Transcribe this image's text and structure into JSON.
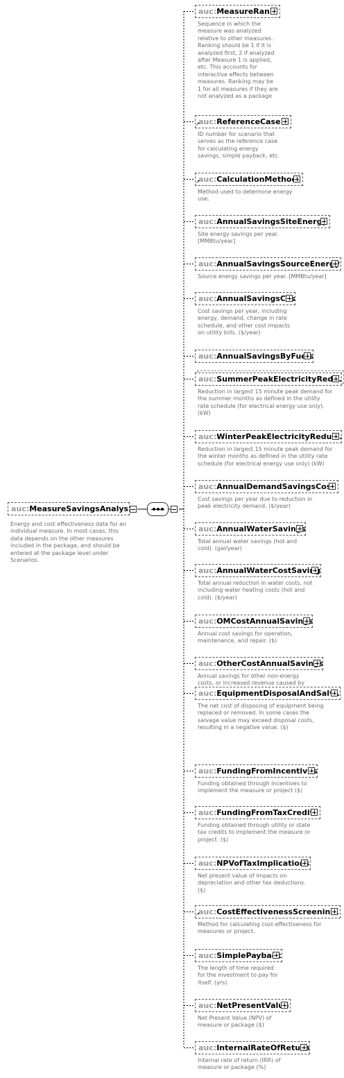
{
  "root": {
    "prefix": "auc:",
    "name": "MeasureSavingsAnalysis",
    "description": [
      "Energy and cost effectiveness data for an",
      "individual measure. In most cases, this",
      "data depends on the other measures",
      "included in the package, and should be",
      "entered at the package level under",
      "Scenarios."
    ]
  },
  "children": [
    {
      "prefix": "auc:",
      "name": "MeasureRank",
      "description": [
        "Sequence in which the",
        "measure was analyzed",
        "relative to other measures.",
        "Ranking should be 1 if it is",
        "analyzed first, 2 if analyzed",
        "after Measure 1 is applied,",
        "etc. This accounts for",
        "interactive effects between",
        "measures. Ranking may be",
        "1 for all measures if they are",
        "not analyzed as a package"
      ]
    },
    {
      "prefix": "auc:",
      "name": "ReferenceCase",
      "description": [
        "ID number for scenario that",
        "serves as the reference case",
        "for calculating energy",
        "savings, simple payback, etc."
      ]
    },
    {
      "prefix": "auc:",
      "name": "CalculationMethod",
      "description": [
        "Method used to determine energy",
        "use."
      ]
    },
    {
      "prefix": "auc:",
      "name": "AnnualSavingsSiteEnergy",
      "description": [
        "Site energy savings per year.",
        "[MMBtu/year]"
      ]
    },
    {
      "prefix": "auc:",
      "name": "AnnualSavingsSourceEnergy",
      "description": [
        "Source energy savings per year. [MMBtu/year]"
      ]
    },
    {
      "prefix": "auc:",
      "name": "AnnualSavingsCost",
      "description": [
        "Cost savings per year, including",
        "energy, demand, change in rate",
        "schedule, and other cost impacts",
        "on utility bills. ($/year)"
      ]
    },
    {
      "prefix": "auc:",
      "name": "AnnualSavingsByFuels",
      "description": []
    },
    {
      "prefix": "auc:",
      "name": "SummerPeakElectricityRed...",
      "description": [
        "Reduction in largest 15 minute peak demand for",
        "the summer months as defined in the utility",
        "rate schedule (for electrical energy use only).",
        "(kW)"
      ]
    },
    {
      "prefix": "auc:",
      "name": "WinterPeakElectricityReduc...",
      "description": [
        "Reduction in largest 15 minute peak demand for",
        "the winter months as defined in the utility rate",
        "schedule (for electrical energy use only) (kW)"
      ]
    },
    {
      "prefix": "auc:",
      "name": "AnnualDemandSavingsCost",
      "description": [
        "Cost savings per year due to reduction in",
        "peak electricity demand. ($/year)"
      ]
    },
    {
      "prefix": "auc:",
      "name": "AnnualWaterSavings",
      "description": [
        "Total annual water savings (hot and",
        "cold). (gal/year)"
      ]
    },
    {
      "prefix": "auc:",
      "name": "AnnualWaterCostSavings",
      "description": [
        "Total annual reduction in water costs, not",
        "including water heating costs (hot and",
        "cold). ($/year)"
      ]
    },
    {
      "prefix": "auc:",
      "name": "OMCostAnnualSavings",
      "description": [
        "Annual cost savings for operation,",
        "maintenance, and repair. ($)"
      ]
    },
    {
      "prefix": "auc:",
      "name": "OtherCostAnnualSavings",
      "description": [
        "Annual savings for other non-energy",
        "costs, or increased revenue caused by",
        "measure implementation. ($)"
      ]
    },
    {
      "prefix": "auc:",
      "name": "EquipmentDisposalAndSalv...",
      "description": [
        "The net cost of disposing of equipment being",
        "replaced or removed. In some cases the",
        "salvage value may exceed disposal costs,",
        "resulting in a negative value. ($)"
      ]
    },
    {
      "prefix": "auc:",
      "name": "FundingFromIncentives",
      "description": [
        "Funding obtained through incentives to",
        "implement the measure or project ($)"
      ]
    },
    {
      "prefix": "auc:",
      "name": "FundingFromTaxCredits",
      "description": [
        "Funding obtained through utility or state",
        "tax credits to implement the measure or",
        "project. ($)"
      ]
    },
    {
      "prefix": "auc:",
      "name": "NPVofTaxImplications",
      "description": [
        "Net present value of impacts on",
        "depreciation and other tax deductions.",
        "($)"
      ]
    },
    {
      "prefix": "auc:",
      "name": "CostEffectivenessScreenin...",
      "description": [
        "Method for calculating cost-effectiveness for",
        "measures or project."
      ]
    },
    {
      "prefix": "auc:",
      "name": "SimplePayback",
      "description": [
        "The length of time required",
        "for the investment to pay for",
        "itself. (yrs)"
      ]
    },
    {
      "prefix": "auc:",
      "name": "NetPresentValue",
      "description": [
        "Net Present Value (NPV) of",
        "measure or package ($)"
      ]
    },
    {
      "prefix": "auc:",
      "name": "InternalRateOfReturn",
      "description": [
        "Internal rate of return (IRR) of",
        "measure or package (%)"
      ]
    }
  ]
}
